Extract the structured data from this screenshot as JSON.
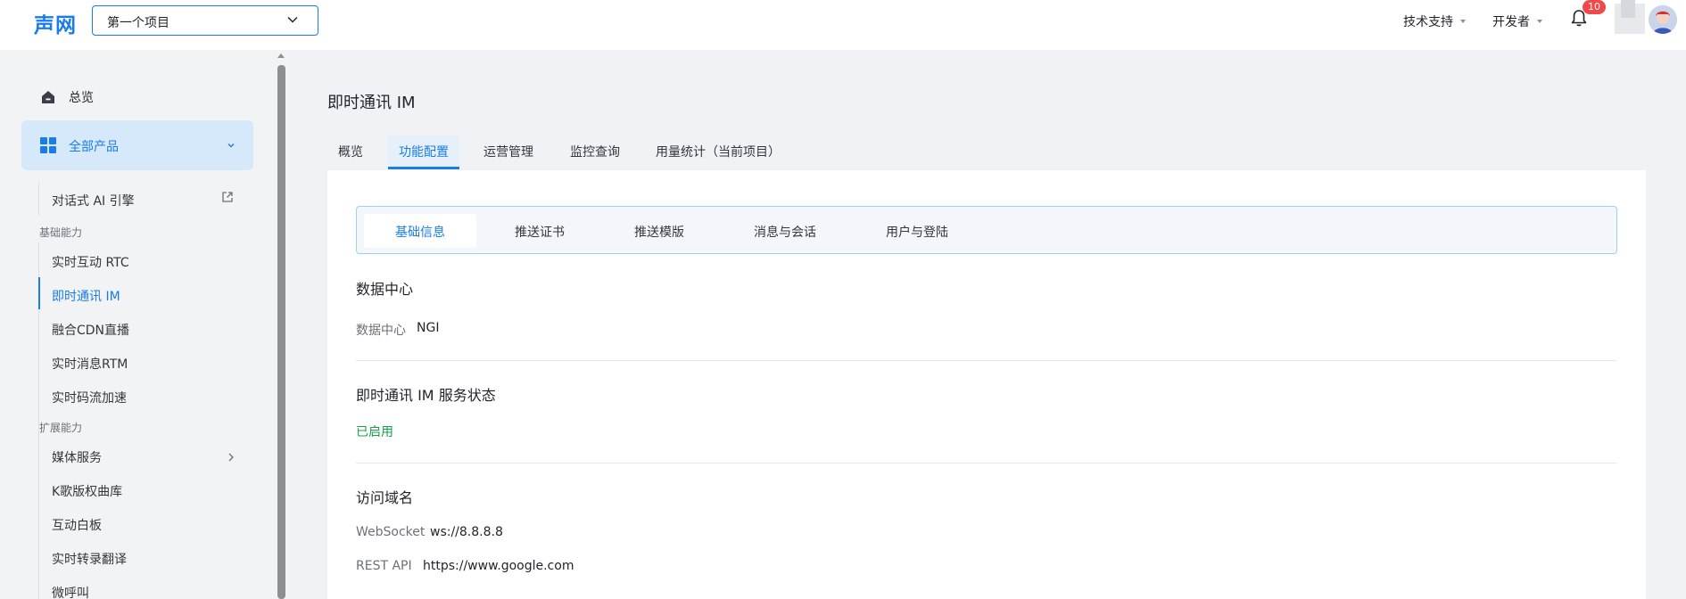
{
  "header": {
    "logo": "声网",
    "project_selector_value": "第一个项目",
    "tech_support_label": "技术支持",
    "developer_label": "开发者",
    "notification_count": "10"
  },
  "sidebar": {
    "overview_label": "总览",
    "all_products_label": "全部产品",
    "conversational_ai_label": "对话式 AI 引擎",
    "section_basic": "基础能力",
    "basic_items": [
      "实时互动 RTC",
      "即时通讯 IM",
      "融合CDN直播",
      "实时消息RTM",
      "实时码流加速"
    ],
    "section_extended": "扩展能力",
    "extended_items": [
      "媒体服务",
      "K歌版权曲库",
      "互动白板",
      "实时转录翻译",
      "微呼叫"
    ]
  },
  "main": {
    "page_title": "即时通讯 IM",
    "tabs": [
      "概览",
      "功能配置",
      "运营管理",
      "监控查询",
      "用量统计（当前项目）"
    ],
    "active_tab": "功能配置",
    "subtabs": [
      "基础信息",
      "推送证书",
      "推送模版",
      "消息与会话",
      "用户与登陆"
    ],
    "active_subtab": "基础信息",
    "data_center": {
      "title": "数据中心",
      "key": "数据中心",
      "value": "NGI"
    },
    "service_status": {
      "title": "即时通讯 IM 服务状态",
      "value": "已启用"
    },
    "domains": {
      "title": "访问域名",
      "websocket_key": "WebSocket",
      "websocket_value": "ws://8.8.8.8",
      "rest_key": "REST API",
      "rest_value": "https://www.google.com"
    }
  },
  "colors": {
    "accent": "#1a7ce8",
    "status_green": "#14a04a",
    "badge_red": "#f3484a"
  }
}
